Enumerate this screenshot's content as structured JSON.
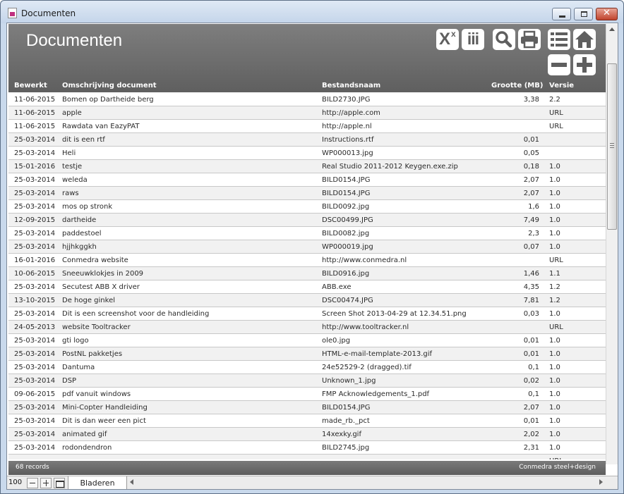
{
  "window": {
    "title": "Documenten",
    "minimize_label": "",
    "maximize_label": "",
    "close_label": "✕"
  },
  "header": {
    "title": "Documenten",
    "toolbar_icons": [
      "export-excel-icon",
      "columns-icon",
      "search-icon",
      "print-icon",
      "list-icon",
      "home-icon",
      "delete-record-icon",
      "new-record-icon"
    ],
    "excel_glyph": "X",
    "excel_sup": "x",
    "columns_glyph": "iii"
  },
  "table": {
    "columns": {
      "date": "Bewerkt",
      "description": "Omschrijving document",
      "filename": "Bestandsnaam",
      "size": "Grootte (MB)",
      "version": "Versie"
    },
    "rows": [
      [
        "11-06-2015",
        "Bomen op Dartheide berg",
        "BILD2730.JPG",
        "3,38",
        "2.2"
      ],
      [
        "11-06-2015",
        "apple",
        "http://apple.com",
        "",
        "URL"
      ],
      [
        "11-06-2015",
        "Rawdata van EazyPAT",
        "http://apple.nl",
        "",
        "URL"
      ],
      [
        "25-03-2014",
        "dit is een rtf",
        "Instructions.rtf",
        "0,01",
        ""
      ],
      [
        "25-03-2014",
        "Heli",
        "WP000013.jpg",
        "0,05",
        ""
      ],
      [
        "15-01-2016",
        "testje",
        "Real Studio 2011-2012 Keygen.exe.zip",
        "0,18",
        "1.0"
      ],
      [
        "25-03-2014",
        "weleda",
        "BILD0154.JPG",
        "2,07",
        "1.0"
      ],
      [
        "25-03-2014",
        "raws",
        "BILD0154.JPG",
        "2,07",
        "1.0"
      ],
      [
        "25-03-2014",
        "mos op stronk",
        "BILD0092.jpg",
        "1,6",
        "1.0"
      ],
      [
        "12-09-2015",
        "dartheide",
        "DSC00499.JPG",
        "7,49",
        "1.0"
      ],
      [
        "25-03-2014",
        "paddestoel",
        "BILD0082.jpg",
        "2,3",
        "1.0"
      ],
      [
        "25-03-2014",
        "hjjhkggkh",
        "WP000019.jpg",
        "0,07",
        "1.0"
      ],
      [
        "16-01-2016",
        "Conmedra website",
        "http://www.conmedra.nl",
        "",
        "URL"
      ],
      [
        "10-06-2015",
        "Sneeuwklokjes in 2009",
        "BILD0916.jpg",
        "1,46",
        "1.1"
      ],
      [
        "25-03-2014",
        "Secutest ABB X driver",
        "ABB.exe",
        "4,35",
        "1.2"
      ],
      [
        "13-10-2015",
        "De hoge ginkel",
        "DSC00474.JPG",
        "7,81",
        "1.2"
      ],
      [
        "25-03-2014",
        "Dit is een screenshot voor de handleiding",
        "Screen Shot 2013-04-29 at 12.34.51.png",
        "0,03",
        "1.0"
      ],
      [
        "24-05-2013",
        "website Tooltracker",
        "http://www.tooltracker.nl",
        "",
        "URL"
      ],
      [
        "25-03-2014",
        "gti logo",
        "ole0.jpg",
        "0,01",
        "1.0"
      ],
      [
        "25-03-2014",
        "PostNL pakketjes",
        "HTML-e-mail-template-2013.gif",
        "0,01",
        "1.0"
      ],
      [
        "25-03-2014",
        "Dantuma",
        "24e52529-2 (dragged).tif",
        "0,1",
        "1.0"
      ],
      [
        "25-03-2014",
        "DSP",
        "Unknown_1.jpg",
        "0,02",
        "1.0"
      ],
      [
        "09-06-2015",
        "pdf vanuit windows",
        "FMP Acknowledgements_1.pdf",
        "0,1",
        "1.0"
      ],
      [
        "25-03-2014",
        "Mini-Copter Handleiding",
        "BILD0154.JPG",
        "2,07",
        "1.0"
      ],
      [
        "25-03-2014",
        "Dit is dan weer een pict",
        "made_rb._pct",
        "0,01",
        "1.0"
      ],
      [
        "25-03-2014",
        "animated gif",
        "14xexky.gif",
        "2,02",
        "1.0"
      ],
      [
        "25-03-2014",
        "rodondendron",
        "BILD2745.jpg",
        "2,31",
        "1.0"
      ],
      [
        "",
        "",
        "",
        "",
        "URL"
      ]
    ]
  },
  "footer": {
    "record_count": "68 records",
    "credit": "Conmedra steel+design"
  },
  "statusbar": {
    "zoom": "100",
    "mode_tab": "Bladeren"
  },
  "colors": {
    "header_bg": "#6e6e6e",
    "row_alt": "#f1f1f1",
    "close_button": "#c0432d"
  }
}
